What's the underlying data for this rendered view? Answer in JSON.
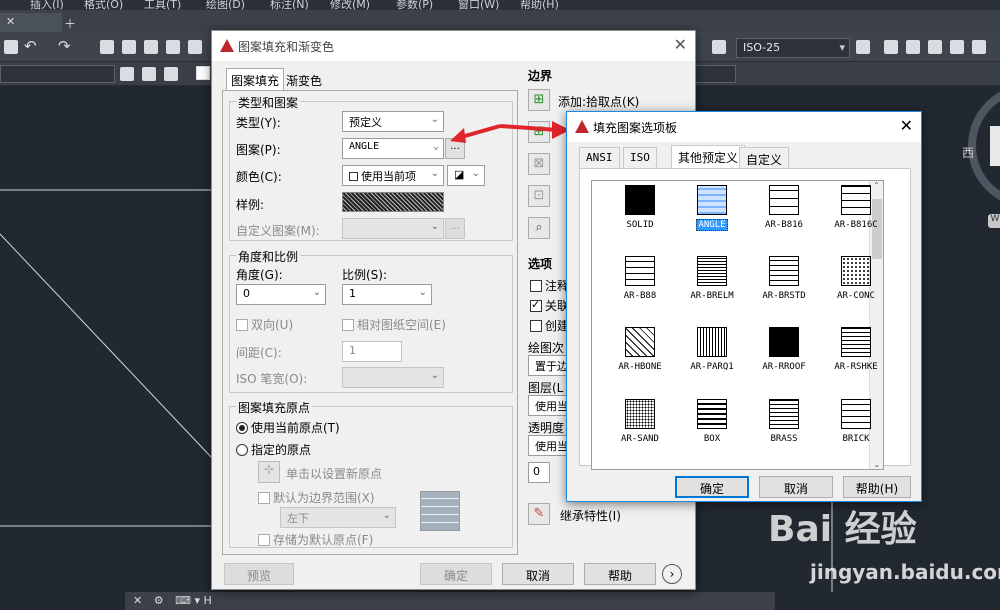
{
  "cad": {
    "tab_labels": [
      "插入(I)",
      "格式(O)",
      "工具(T)",
      "绘图(D)",
      "标注(N)",
      "修改(M)",
      "参数(P)",
      "窗口(W)",
      "帮助(H)"
    ],
    "dimstyle_value": "ISO-25",
    "compass_label": "西",
    "compass_tag": "W",
    "command_text": "⌨ ▾ H"
  },
  "hatch_dialog": {
    "title": "图案填充和渐变色",
    "tabs": [
      "图案填充",
      "渐变色"
    ],
    "type_pattern": {
      "group_label": "类型和图案",
      "type_label": "类型(Y):",
      "type_value": "预定义",
      "pattern_label": "图案(P):",
      "pattern_value": "ANGLE",
      "browse_label": "...",
      "color_label": "颜色(C):",
      "color_value": "使用当前项",
      "sample_label": "样例:",
      "custom_label": "自定义图案(M):"
    },
    "angle_scale": {
      "group_label": "角度和比例",
      "angle_label": "角度(G):",
      "angle_value": "0",
      "scale_label": "比例(S):",
      "scale_value": "1",
      "double_label": "双向(U)",
      "relative_label": "相对图纸空间(E)",
      "spacing_label": "间距(C):",
      "spacing_value": "1",
      "iso_label": "ISO 笔宽(O):"
    },
    "origin": {
      "group_label": "图案填充原点",
      "use_current_label": "使用当前原点(T)",
      "specified_label": "指定的原点",
      "click_label": "单击以设置新原点",
      "default_ext_label": "默认为边界范围(X)",
      "position_value": "左下",
      "store_label": "存储为默认原点(F)"
    },
    "boundary": {
      "header": "边界",
      "add_pick_label": "添加:拾取点(K)"
    },
    "options": {
      "header": "选项",
      "annotative_label": "注释",
      "associative_label": "关联",
      "create_label": "创建",
      "draw_order_label": "绘图次",
      "draw_order_value": "置于边",
      "layer_label": "图层(L",
      "layer_value": "使用当",
      "transparency_label": "透明度",
      "transparency_value": "使用当",
      "transparency_num": "0"
    },
    "inherit_label": "继承特性(I)",
    "buttons": {
      "preview": "预览",
      "ok": "确定",
      "cancel": "取消",
      "help": "帮助"
    }
  },
  "palette": {
    "title": "填充图案选项板",
    "tabs": [
      "ANSI",
      "ISO",
      "其他预定义",
      "自定义"
    ],
    "patterns": [
      "SOLID",
      "ANGLE",
      "AR-B816",
      "AR-B816C",
      "AR-B88",
      "AR-BRELM",
      "AR-BRSTD",
      "AR-CONC",
      "AR-HBONE",
      "AR-PARQ1",
      "AR-RROOF",
      "AR-RSHKE",
      "AR-SAND",
      "BOX",
      "BRASS",
      "BRICK"
    ],
    "selected": "ANGLE",
    "buttons": {
      "ok": "确定",
      "cancel": "取消",
      "help": "帮助(H)"
    }
  },
  "watermark": {
    "brand": "Bai 经验",
    "url": "jingyan.baidu.com"
  },
  "colors": {
    "accent_red": "#e0252b",
    "selection": "#3399ff",
    "cad_bg": "#212830"
  }
}
